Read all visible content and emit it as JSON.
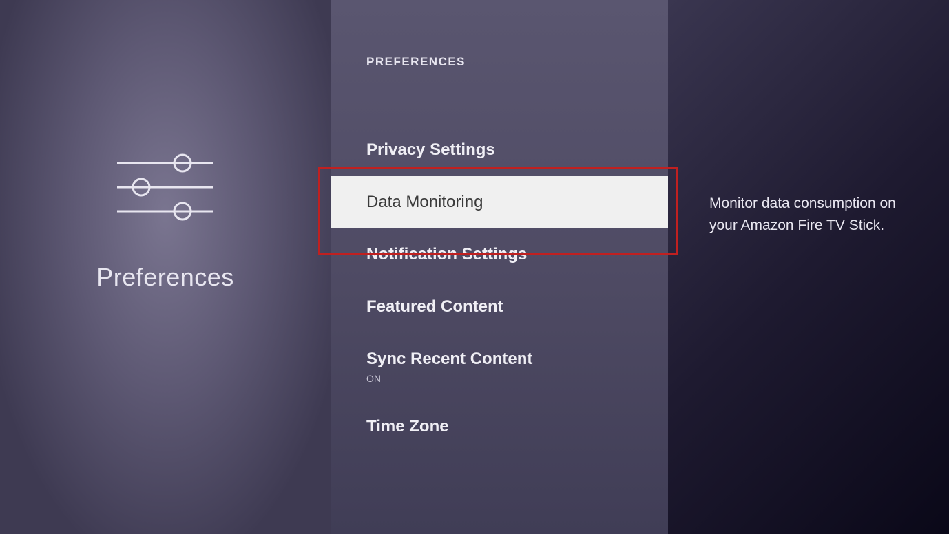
{
  "left": {
    "title": "Preferences"
  },
  "middle": {
    "header": "PREFERENCES",
    "items": [
      {
        "label": "Privacy Settings",
        "subtext": null,
        "selected": false
      },
      {
        "label": "Data Monitoring",
        "subtext": null,
        "selected": true
      },
      {
        "label": "Notification Settings",
        "subtext": null,
        "selected": false
      },
      {
        "label": "Featured Content",
        "subtext": null,
        "selected": false
      },
      {
        "label": "Sync Recent Content",
        "subtext": "ON",
        "selected": false
      },
      {
        "label": "Time Zone",
        "subtext": null,
        "selected": false
      }
    ]
  },
  "right": {
    "description": "Monitor data consumption on your Amazon Fire TV Stick."
  }
}
